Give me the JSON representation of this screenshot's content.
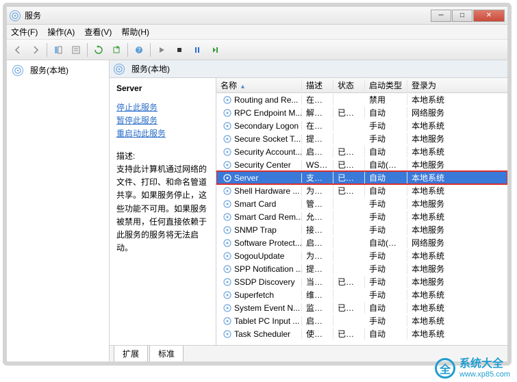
{
  "window": {
    "title": "服务"
  },
  "menu": {
    "file": "文件(F)",
    "action": "操作(A)",
    "view": "查看(V)",
    "help": "帮助(H)"
  },
  "tree": {
    "root": "服务(本地)"
  },
  "pane": {
    "header": "服务(本地)"
  },
  "detail": {
    "name": "Server",
    "stop": "停止此服务",
    "pause": "暂停此服务",
    "restart": "重启动此服务",
    "desc_label": "描述:",
    "desc_text": "支持此计算机通过网络的文件、打印、和命名管道共享。如果服务停止，这些功能不可用。如果服务被禁用，任何直接依赖于此服务的服务将无法启动。"
  },
  "columns": {
    "name": "名称",
    "desc": "描述",
    "status": "状态",
    "startup": "启动类型",
    "logon": "登录为"
  },
  "services": [
    {
      "name": "Routing and Re...",
      "desc": "在局...",
      "status": "",
      "type": "禁用",
      "logon": "本地系统"
    },
    {
      "name": "RPC Endpoint M...",
      "desc": "解析...",
      "status": "已启动",
      "type": "自动",
      "logon": "网络服务"
    },
    {
      "name": "Secondary Logon",
      "desc": "在不...",
      "status": "",
      "type": "手动",
      "logon": "本地系统"
    },
    {
      "name": "Secure Socket T...",
      "desc": "提供...",
      "status": "",
      "type": "手动",
      "logon": "本地服务"
    },
    {
      "name": "Security Account...",
      "desc": "启动...",
      "status": "已启动",
      "type": "自动",
      "logon": "本地系统"
    },
    {
      "name": "Security Center",
      "desc": "WSC...",
      "status": "已启动",
      "type": "自动(延迟...",
      "logon": "本地服务"
    },
    {
      "name": "Server",
      "desc": "支持...",
      "status": "已启动",
      "type": "自动",
      "logon": "本地系统",
      "selected": true
    },
    {
      "name": "Shell Hardware ...",
      "desc": "为自...",
      "status": "已启动",
      "type": "自动",
      "logon": "本地系统"
    },
    {
      "name": "Smart Card",
      "desc": "管理...",
      "status": "",
      "type": "手动",
      "logon": "本地服务"
    },
    {
      "name": "Smart Card Rem...",
      "desc": "允许...",
      "status": "",
      "type": "手动",
      "logon": "本地系统"
    },
    {
      "name": "SNMP Trap",
      "desc": "接收...",
      "status": "",
      "type": "手动",
      "logon": "本地服务"
    },
    {
      "name": "Software Protect...",
      "desc": "启用...",
      "status": "",
      "type": "自动(延迟...",
      "logon": "网络服务"
    },
    {
      "name": "SogouUpdate",
      "desc": "为搜...",
      "status": "",
      "type": "手动",
      "logon": "本地系统"
    },
    {
      "name": "SPP Notification ...",
      "desc": "提供...",
      "status": "",
      "type": "手动",
      "logon": "本地服务"
    },
    {
      "name": "SSDP Discovery",
      "desc": "当发...",
      "status": "已启动",
      "type": "手动",
      "logon": "本地服务"
    },
    {
      "name": "Superfetch",
      "desc": "维护...",
      "status": "",
      "type": "手动",
      "logon": "本地系统"
    },
    {
      "name": "System Event N...",
      "desc": "监视...",
      "status": "已启动",
      "type": "自动",
      "logon": "本地系统"
    },
    {
      "name": "Tablet PC Input ...",
      "desc": "启用...",
      "status": "",
      "type": "手动",
      "logon": "本地系统"
    },
    {
      "name": "Task Scheduler",
      "desc": "使用...",
      "status": "已启动",
      "type": "自动",
      "logon": "本地系统"
    }
  ],
  "tabs": {
    "extended": "扩展",
    "standard": "标准"
  },
  "watermark": {
    "name": "系统大全",
    "url": "www.xp85.com"
  }
}
